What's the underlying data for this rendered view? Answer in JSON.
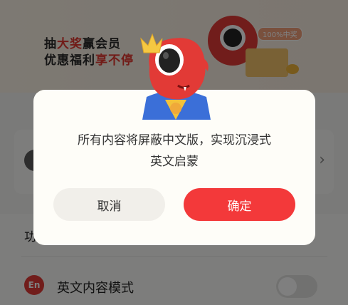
{
  "banner": {
    "line1_pre": "抽",
    "line1_hl": "大奖",
    "line1_post": "赢会员",
    "line2_pre": "优惠福利",
    "line2_hl": "享不停",
    "badge": "100%中奖"
  },
  "settings": {
    "function_label": "功",
    "english_mode_icon": "En",
    "english_mode_label": "英文内容模式",
    "english_mode_on": false
  },
  "dialog": {
    "message_line1": "所有内容将屏蔽中文版，实现沉浸式",
    "message_line2": "英文启蒙",
    "cancel_label": "取消",
    "confirm_label": "确定"
  },
  "colors": {
    "accent": "#f3393a",
    "mascot_red": "#e23a36",
    "crown": "#f5c842",
    "scarf": "#3b6fd8"
  },
  "icons": {
    "mascot": "one-eyed-red-mascot-icon",
    "chevron": "chevron-right-icon",
    "crown": "crown-icon"
  }
}
